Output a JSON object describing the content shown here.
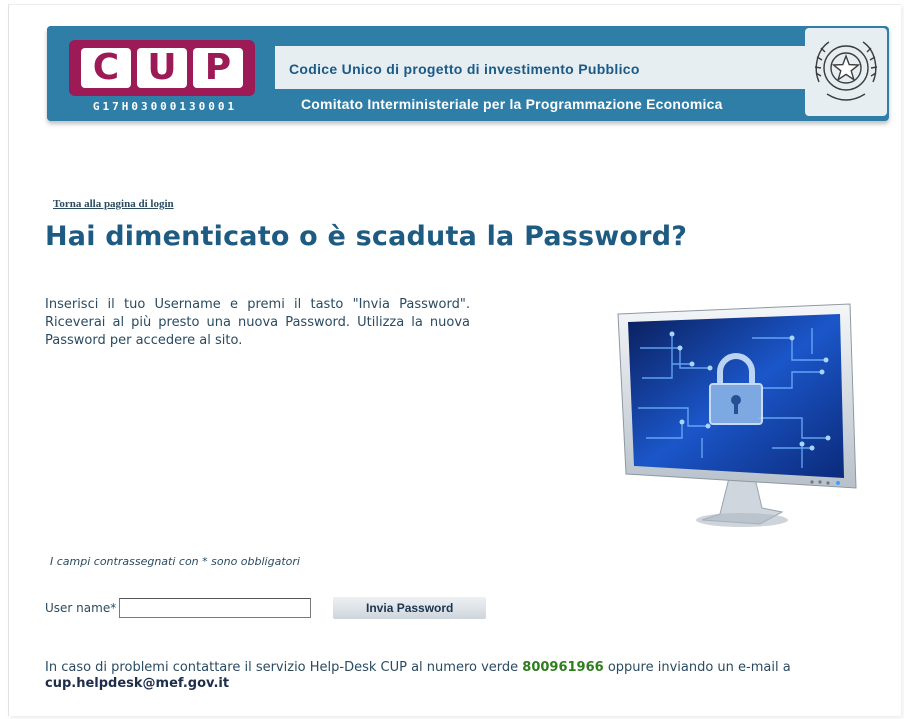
{
  "header": {
    "logo_letters": [
      "C",
      "U",
      "P"
    ],
    "logo_code": "G17H03000130001",
    "title": "Codice Unico di progetto di investimento Pubblico",
    "subtitle": "Comitato Interministeriale per la Programmazione Economica",
    "emblem_icon": "italian-republic-emblem-icon",
    "colors": {
      "brand_blue": "#2e7ea8",
      "logo_magenta": "#9c1a55"
    }
  },
  "nav": {
    "back_link": "Torna alla pagina di login"
  },
  "page": {
    "title": "Hai dimenticato o è scaduta la Password?",
    "intro": "Inserisci il tuo Username e premi il tasto \"Invia Password\". Riceverai al più presto una nuova Password. Utilizza la nuova Password per accedere al sito.",
    "illustration_icon": "monitor-padlock-icon"
  },
  "form": {
    "required_note": "I campi contrassegnati con * sono obbligatori",
    "username_label": "User name*",
    "username_value": "",
    "submit_label": "Invia Password"
  },
  "help": {
    "text_before": "In caso di problemi contattare il servizio Help-Desk CUP al numero verde ",
    "phone": "800961966",
    "text_middle": " oppure inviando un e-mail a ",
    "email": "cup.helpdesk@mef.gov.it"
  }
}
